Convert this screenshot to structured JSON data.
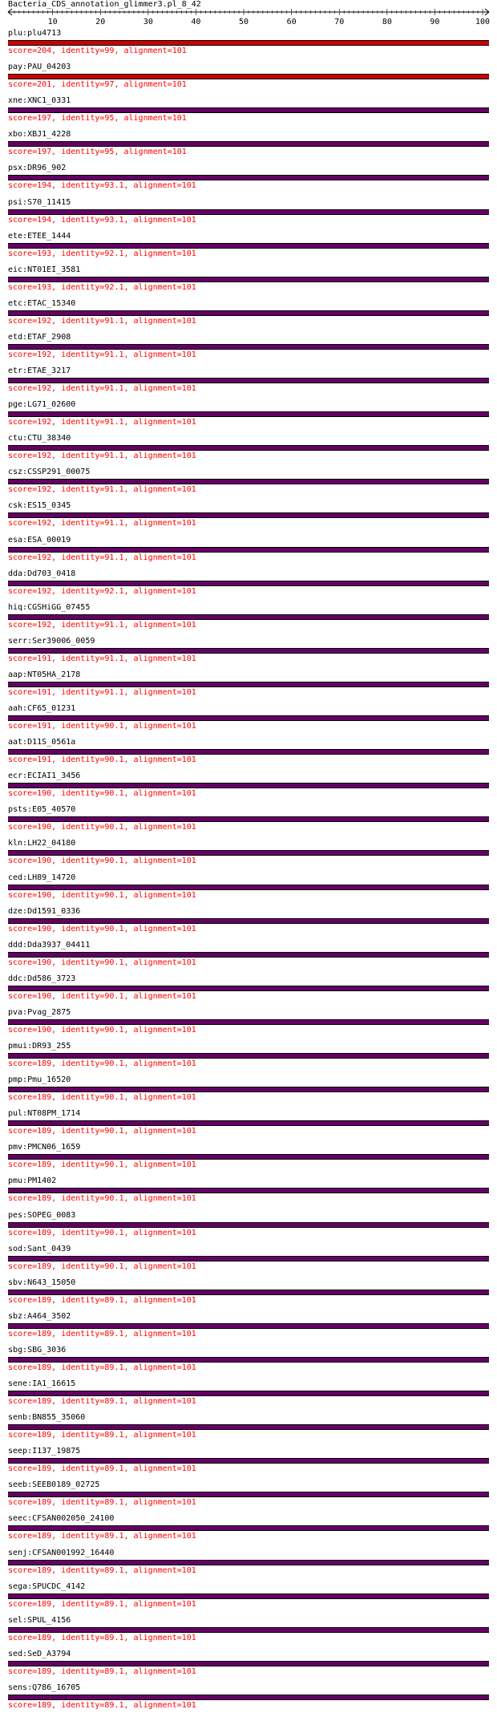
{
  "title": "Bacteria_CDS_annotation_glimmer3.pl_8_42",
  "ruler": {
    "min": 1,
    "max": 101,
    "labels": [
      "10",
      "20",
      "30",
      "40",
      "50",
      "60",
      "70",
      "80",
      "90",
      "100"
    ],
    "label_values": [
      10,
      20,
      30,
      40,
      50,
      60,
      70,
      80,
      90,
      100
    ]
  },
  "colors": {
    "top_bar": "#cc0000",
    "bar": "#660066",
    "bar_edge": "#000000",
    "score_text": "#ff0000",
    "label_text": "#000000"
  },
  "hits": [
    {
      "label": "plu:plu4713",
      "stats": "score=204, identity=99, alignment=101",
      "bar_color": "#cc0000"
    },
    {
      "label": "pay:PAU_04203",
      "stats": "score=201, identity=97, alignment=101",
      "bar_color": "#cc0000"
    },
    {
      "label": "xne:XNC1_0331",
      "stats": "score=197, identity=95, alignment=101",
      "bar_color": "#660066"
    },
    {
      "label": "xbo:XBJ1_4228",
      "stats": "score=197, identity=95, alignment=101",
      "bar_color": "#660066"
    },
    {
      "label": "psx:DR96_902",
      "stats": "score=194, identity=93.1, alignment=101",
      "bar_color": "#660066"
    },
    {
      "label": "psi:S70_11415",
      "stats": "score=194, identity=93.1, alignment=101",
      "bar_color": "#660066"
    },
    {
      "label": "ete:ETEE_1444",
      "stats": "score=193, identity=92.1, alignment=101",
      "bar_color": "#660066"
    },
    {
      "label": "eic:NT01EI_3581",
      "stats": "score=193, identity=92.1, alignment=101",
      "bar_color": "#660066"
    },
    {
      "label": "etc:ETAC_15340",
      "stats": "score=192, identity=91.1, alignment=101",
      "bar_color": "#660066"
    },
    {
      "label": "etd:ETAF_2908",
      "stats": "score=192, identity=91.1, alignment=101",
      "bar_color": "#660066"
    },
    {
      "label": "etr:ETAE_3217",
      "stats": "score=192, identity=91.1, alignment=101",
      "bar_color": "#660066"
    },
    {
      "label": "pge:LG71_02600",
      "stats": "score=192, identity=91.1, alignment=101",
      "bar_color": "#660066"
    },
    {
      "label": "ctu:CTU_38340",
      "stats": "score=192, identity=91.1, alignment=101",
      "bar_color": "#660066"
    },
    {
      "label": "csz:CSSP291_00075",
      "stats": "score=192, identity=91.1, alignment=101",
      "bar_color": "#660066"
    },
    {
      "label": "csk:ES15_0345",
      "stats": "score=192, identity=91.1, alignment=101",
      "bar_color": "#660066"
    },
    {
      "label": "esa:ESA_00019",
      "stats": "score=192, identity=91.1, alignment=101",
      "bar_color": "#660066"
    },
    {
      "label": "dda:Dd703_0418",
      "stats": "score=192, identity=92.1, alignment=101",
      "bar_color": "#660066"
    },
    {
      "label": "hiq:CGSHiGG_07455",
      "stats": "score=192, identity=91.1, alignment=101",
      "bar_color": "#660066"
    },
    {
      "label": "serr:Ser39006_0059",
      "stats": "score=191, identity=91.1, alignment=101",
      "bar_color": "#660066"
    },
    {
      "label": "aap:NT05HA_2178",
      "stats": "score=191, identity=91.1, alignment=101",
      "bar_color": "#660066"
    },
    {
      "label": "aah:CF65_01231",
      "stats": "score=191, identity=90.1, alignment=101",
      "bar_color": "#660066"
    },
    {
      "label": "aat:D11S_0561a",
      "stats": "score=191, identity=90.1, alignment=101",
      "bar_color": "#660066"
    },
    {
      "label": "ecr:ECIAI1_3456",
      "stats": "score=190, identity=90.1, alignment=101",
      "bar_color": "#660066"
    },
    {
      "label": "psts:E05_40570",
      "stats": "score=190, identity=90.1, alignment=101",
      "bar_color": "#660066"
    },
    {
      "label": "kln:LH22_04180",
      "stats": "score=190, identity=90.1, alignment=101",
      "bar_color": "#660066"
    },
    {
      "label": "ced:LH89_14720",
      "stats": "score=190, identity=90.1, alignment=101",
      "bar_color": "#660066"
    },
    {
      "label": "dze:Dd1591_0336",
      "stats": "score=190, identity=90.1, alignment=101",
      "bar_color": "#660066"
    },
    {
      "label": "ddd:Dda3937_04411",
      "stats": "score=190, identity=90.1, alignment=101",
      "bar_color": "#660066"
    },
    {
      "label": "ddc:Dd586_3723",
      "stats": "score=190, identity=90.1, alignment=101",
      "bar_color": "#660066"
    },
    {
      "label": "pva:Pvag_2875",
      "stats": "score=190, identity=90.1, alignment=101",
      "bar_color": "#660066"
    },
    {
      "label": "pmui:DR93_255",
      "stats": "score=189, identity=90.1, alignment=101",
      "bar_color": "#660066"
    },
    {
      "label": "pmp:Pmu_16520",
      "stats": "score=189, identity=90.1, alignment=101",
      "bar_color": "#660066"
    },
    {
      "label": "pul:NT08PM_1714",
      "stats": "score=189, identity=90.1, alignment=101",
      "bar_color": "#660066"
    },
    {
      "label": "pmv:PMCN06_1659",
      "stats": "score=189, identity=90.1, alignment=101",
      "bar_color": "#660066"
    },
    {
      "label": "pmu:PM1402",
      "stats": "score=189, identity=90.1, alignment=101",
      "bar_color": "#660066"
    },
    {
      "label": "pes:SOPEG_0083",
      "stats": "score=189, identity=90.1, alignment=101",
      "bar_color": "#660066"
    },
    {
      "label": "sod:Sant_0439",
      "stats": "score=189, identity=90.1, alignment=101",
      "bar_color": "#660066"
    },
    {
      "label": "sbv:N643_15050",
      "stats": "score=189, identity=89.1, alignment=101",
      "bar_color": "#660066"
    },
    {
      "label": "sbz:A464_3502",
      "stats": "score=189, identity=89.1, alignment=101",
      "bar_color": "#660066"
    },
    {
      "label": "sbg:SBG_3036",
      "stats": "score=189, identity=89.1, alignment=101",
      "bar_color": "#660066"
    },
    {
      "label": "sene:IA1_16615",
      "stats": "score=189, identity=89.1, alignment=101",
      "bar_color": "#660066"
    },
    {
      "label": "senb:BN855_35060",
      "stats": "score=189, identity=89.1, alignment=101",
      "bar_color": "#660066"
    },
    {
      "label": "seep:I137_19875",
      "stats": "score=189, identity=89.1, alignment=101",
      "bar_color": "#660066"
    },
    {
      "label": "seeb:SEEB0189_02725",
      "stats": "score=189, identity=89.1, alignment=101",
      "bar_color": "#660066"
    },
    {
      "label": "seec:CFSAN002050_24100",
      "stats": "score=189, identity=89.1, alignment=101",
      "bar_color": "#660066"
    },
    {
      "label": "senj:CFSAN001992_16440",
      "stats": "score=189, identity=89.1, alignment=101",
      "bar_color": "#660066"
    },
    {
      "label": "sega:SPUCDC_4142",
      "stats": "score=189, identity=89.1, alignment=101",
      "bar_color": "#660066"
    },
    {
      "label": "sel:SPUL_4156",
      "stats": "score=189, identity=89.1, alignment=101",
      "bar_color": "#660066"
    },
    {
      "label": "sed:SeD_A3794",
      "stats": "score=189, identity=89.1, alignment=101",
      "bar_color": "#660066"
    },
    {
      "label": "sens:Q786_16705",
      "stats": "score=189, identity=89.1, alignment=101",
      "bar_color": "#660066"
    }
  ]
}
